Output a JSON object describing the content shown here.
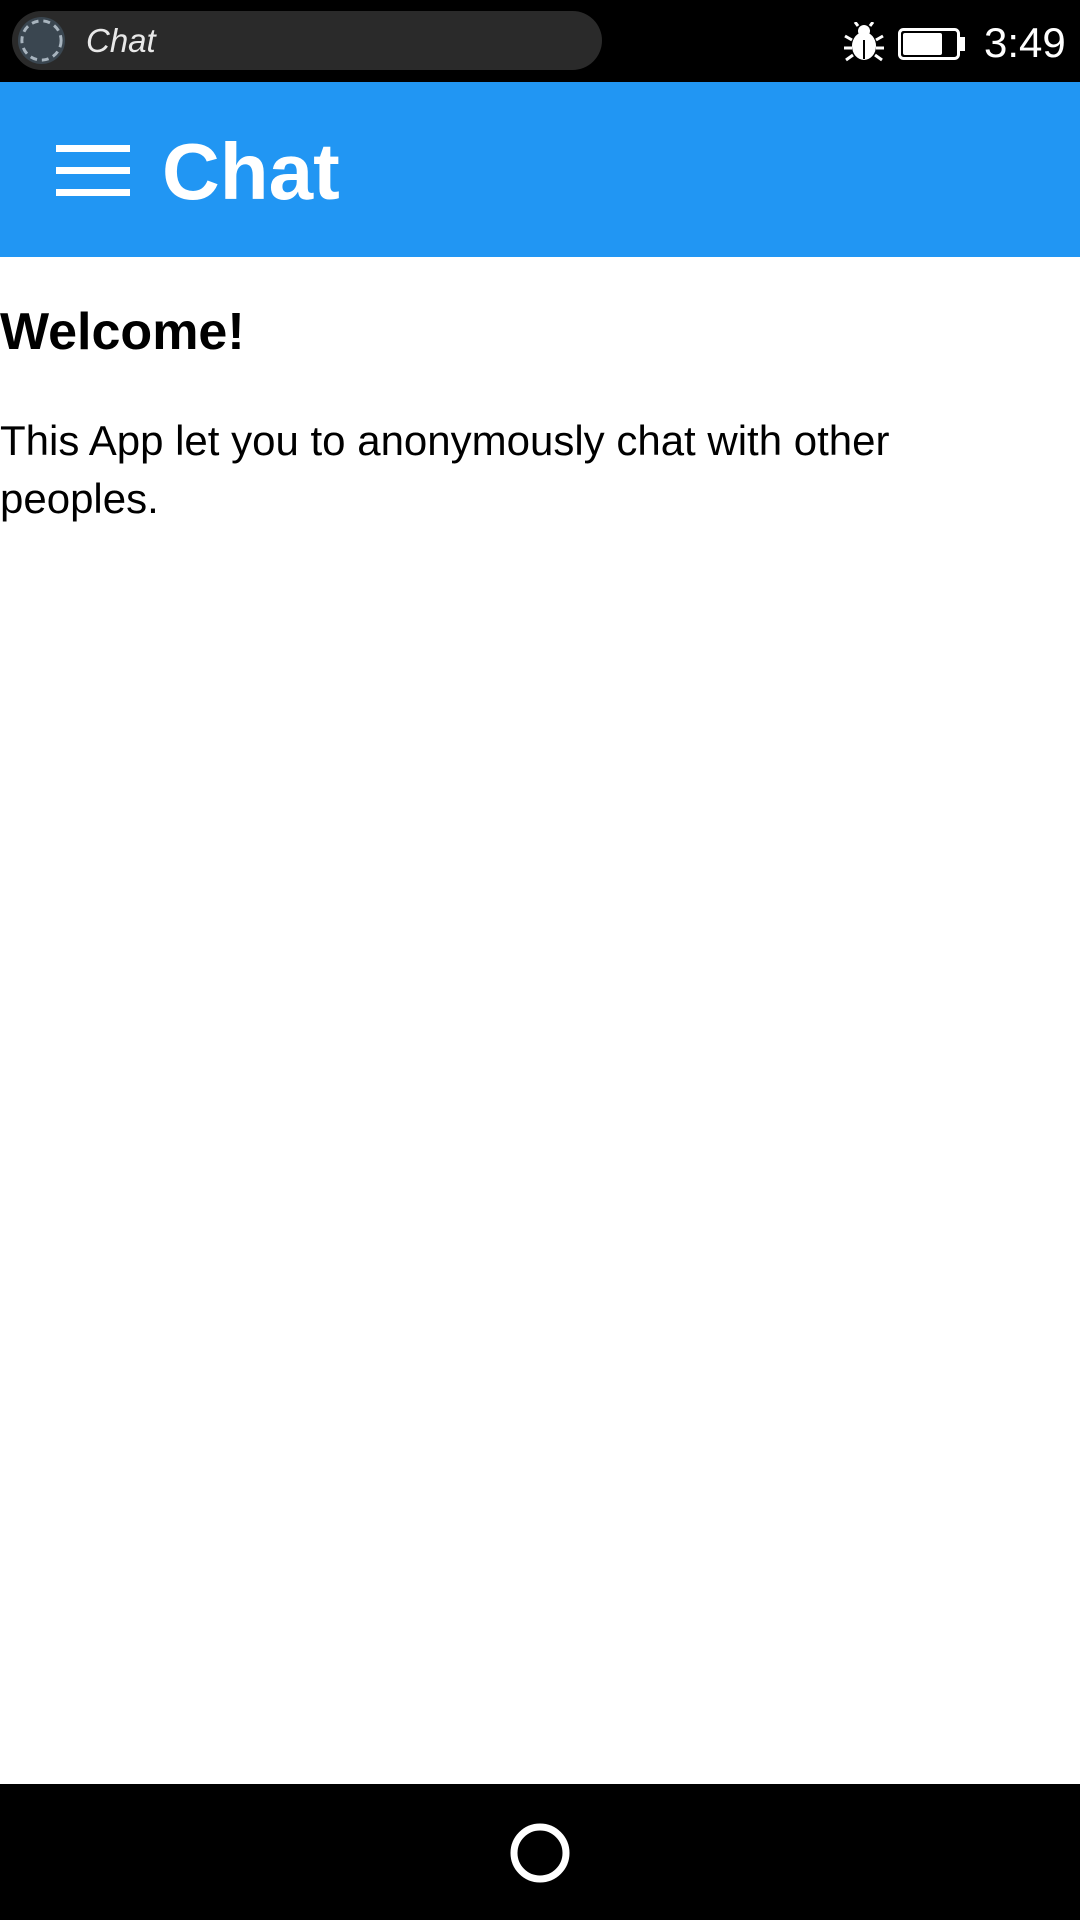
{
  "status_bar": {
    "task_label": "Chat",
    "clock": "3:49",
    "icons": [
      "task-progress-icon",
      "bug-icon",
      "battery-icon"
    ]
  },
  "app_bar": {
    "title": "Chat",
    "menu_icon": "hamburger-menu-icon",
    "background_color": "#2196f3"
  },
  "content": {
    "heading": "Welcome!",
    "body": "This App let you to anonymously chat with other peoples."
  },
  "nav_bar": {
    "home_icon": "home-circle-icon"
  }
}
